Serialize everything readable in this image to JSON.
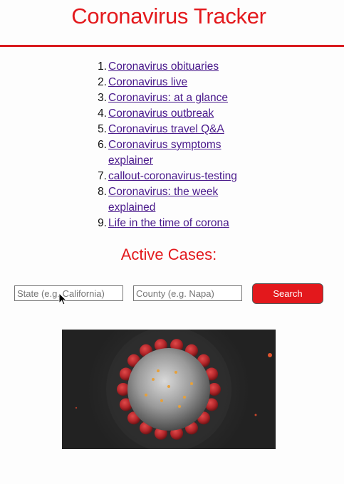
{
  "header": {
    "title": "Coronavirus Tracker"
  },
  "links": [
    {
      "num": "1.",
      "label": "Coronavirus obituaries"
    },
    {
      "num": "2.",
      "label": "Coronavirus live"
    },
    {
      "num": "3.",
      "label": "Coronavirus: at a glance"
    },
    {
      "num": "4.",
      "label": "Coronavirus outbreak"
    },
    {
      "num": "5.",
      "label": "Coronavirus travel Q&A"
    },
    {
      "num": "6.",
      "label": "Coronavirus symptoms explainer"
    },
    {
      "num": "7.",
      "label": "callout-coronavirus-testing"
    },
    {
      "num": "8.",
      "label": "Coronavirus: the week explained"
    },
    {
      "num": "9.",
      "label": "Life in the time of corona"
    }
  ],
  "active_cases": {
    "heading": "Active Cases:"
  },
  "search": {
    "state_placeholder": "State (e.g. California)",
    "state_value": "",
    "county_placeholder": "County (e.g. Napa)",
    "county_value": "",
    "button_label": "Search"
  },
  "icons": {
    "cursor": "mouse-pointer-icon"
  },
  "colors": {
    "accent": "#e3191d",
    "link": "#4a1a8c",
    "button": "#e3181c",
    "virus_spike": "#b3262a",
    "image_bg": "#222222"
  }
}
